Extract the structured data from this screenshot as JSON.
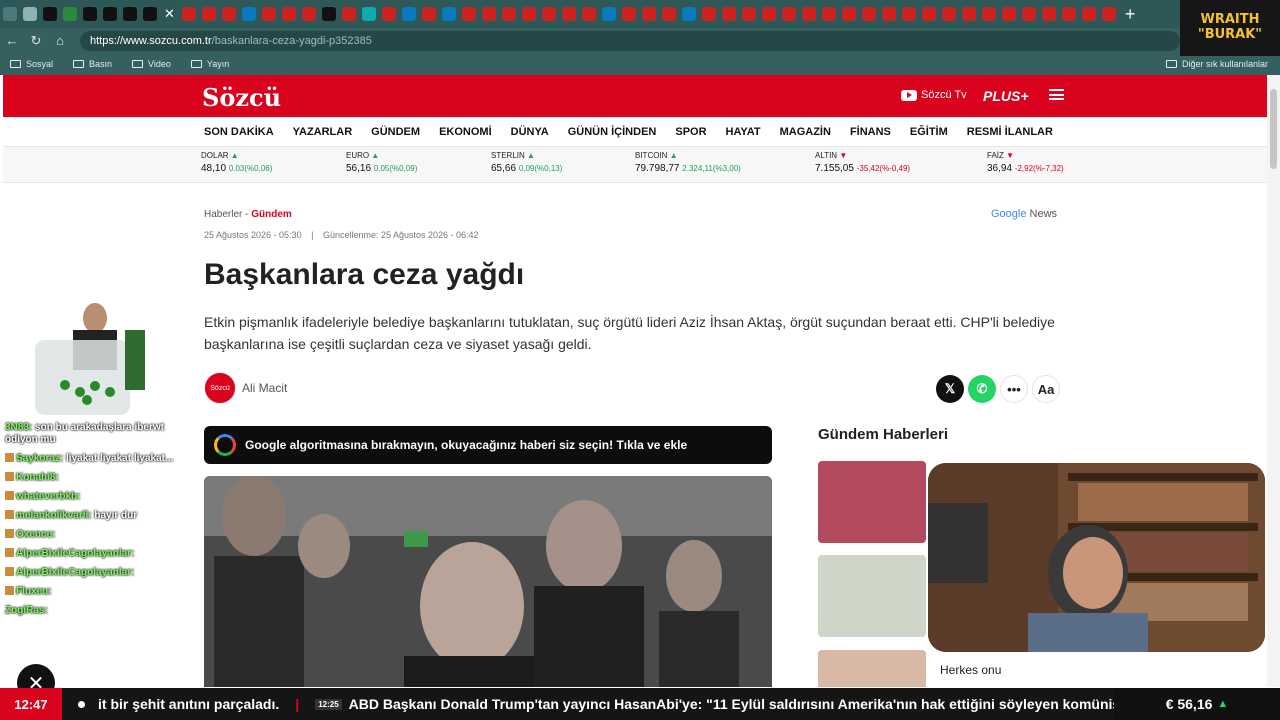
{
  "browser": {
    "url_host": "https://www.sozcu.com.tr",
    "url_path": "/baskanlara-ceza-yagdi-p352385",
    "bookmarks": [
      "Sosyal",
      "Basın",
      "Video",
      "Yayın"
    ],
    "bookmarks_right": "Diğer sık kullanılanlar"
  },
  "overlay_badge": {
    "line1": "WRAITH",
    "line2": "\"BURAK\""
  },
  "site": {
    "logo": "Sözcü",
    "sozcu_tv": "Sözcü Tv",
    "plus": "PLUS+",
    "nav": [
      "SON DAKİKA",
      "YAZARLAR",
      "GÜNDEM",
      "EKONOMİ",
      "DÜNYA",
      "GÜNÜN İÇİNDEN",
      "SPOR",
      "HAYAT",
      "MAGAZİN",
      "FİNANS",
      "EĞİTİM",
      "RESMİ İLANLAR"
    ]
  },
  "markets": [
    {
      "name": "DOLAR",
      "value": "48,10",
      "change": "0.03(%0,06)",
      "dir": "up"
    },
    {
      "name": "EURO",
      "value": "56,16",
      "change": "0.05(%0,09)",
      "dir": "up"
    },
    {
      "name": "STERLIN",
      "value": "65,66",
      "change": "0,09(%0,13)",
      "dir": "up"
    },
    {
      "name": "BITCOIN",
      "value": "79.798,77",
      "change": "2.324,11(%3,00)",
      "dir": "up"
    },
    {
      "name": "ALTIN",
      "value": "7.155,05",
      "change": "-35,42(%-0,49)",
      "dir": "down"
    },
    {
      "name": "FAİZ",
      "value": "36,94",
      "change": "-2,92(%-7,32)",
      "dir": "down"
    }
  ],
  "article": {
    "breadcrumb_root": "Haberler -",
    "breadcrumb_cat": "Gündem",
    "google_news_g": "Google",
    "google_news_n": "News",
    "published": "25 Ağustos 2026 - 05:30",
    "updated": "Güncellenme: 25 Ağustos 2026 - 06:42",
    "title": "Başkanlara ceza yağdı",
    "lead": "Etkin pişmanlık ifadeleriyle belediye başkanlarını tutuklatan, suç örgütü lideri Aziz İhsan Aktaş, örgüt suçundan beraat etti. CHP'li belediye başkanlarına ise çeşitli suçlardan ceza ve siyaset yasağı geldi.",
    "author_avatar": "Sözcü",
    "author": "Ali Macit",
    "font_btn": "Aa",
    "google_bar": "Google algoritmasına bırakmayın, okuyacağınız haberi siz seçin! Tıkla ve ekle"
  },
  "sidebar": {
    "heading": "Gündem Haberleri",
    "partial_headline": "Herkes onu"
  },
  "chat": [
    {
      "user": "3N83:",
      "msg": "son bu arakadaşlara iberwt ödiyon mu"
    },
    {
      "user": "Saykoraz:",
      "msg": "liyakat liyakat liyakat..."
    },
    {
      "user": "Konahi8:",
      "msg": ""
    },
    {
      "user": "whateverbkb:",
      "msg": ""
    },
    {
      "user": "melankolikvarli:",
      "msg": "hayır dur"
    },
    {
      "user": "Oxence:",
      "msg": ""
    },
    {
      "user": "AlperBixileCagolayanlar:",
      "msg": ""
    },
    {
      "user": "AlperBixileCagolayanlar:",
      "msg": ""
    },
    {
      "user": "Fluxeu:",
      "msg": ""
    },
    {
      "user": "ZogiRas:",
      "msg": ""
    }
  ],
  "ticker": {
    "time": "12:47",
    "item1": "it bir şehit anıtını parçaladı.",
    "item2_time": "12:25",
    "item2": "ABD Başkanı Donald Trump'tan yayıncı HasanAbi'ye: \"11 Eylül saldırısını Amerika'nın hak ettiğini söyleyen komünist fa",
    "rate": "€ 56,16"
  }
}
